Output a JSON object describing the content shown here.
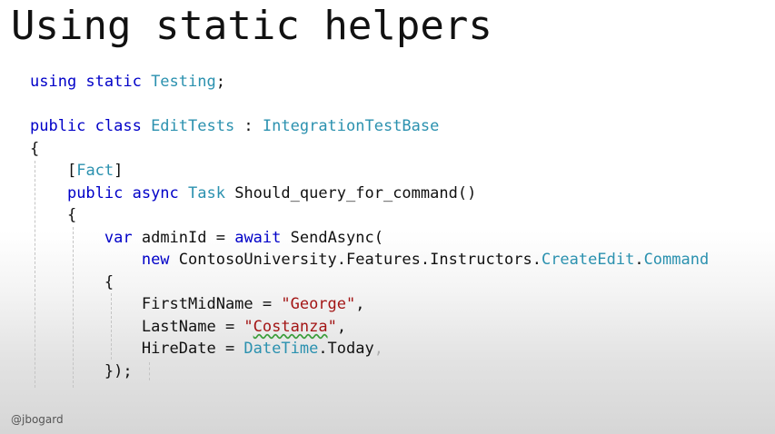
{
  "slide": {
    "title": "Using static helpers",
    "author_handle": "@jbogard"
  },
  "code": {
    "l1": [
      "using static ",
      "Testing",
      ";"
    ],
    "l3": [
      "public class ",
      "EditTests",
      " : ",
      "IntegrationTestBase"
    ],
    "l4": [
      "{"
    ],
    "l5": [
      "[",
      "Fact",
      "]"
    ],
    "l6": [
      "public async ",
      "Task",
      " Should_query_for_command()"
    ],
    "l7": [
      "{"
    ],
    "l8": [
      "var ",
      "adminId = ",
      "await ",
      "SendAsync("
    ],
    "l9": [
      "new ",
      "ContosoUniversity.Features.Instructors.",
      "CreateEdit",
      ".",
      "Command"
    ],
    "l10": [
      "{"
    ],
    "l11": [
      "FirstMidName = ",
      "\"George\"",
      ","
    ],
    "l12": [
      "LastName = ",
      "\"",
      "Costanza",
      "\"",
      ","
    ],
    "l13": [
      "HireDate = ",
      "DateTime",
      ".Today",
      ","
    ],
    "l14": [
      "});"
    ]
  },
  "colors": {
    "keyword": "#0000c8",
    "type": "#2b91af",
    "string": "#a31515",
    "text": "#111111"
  }
}
